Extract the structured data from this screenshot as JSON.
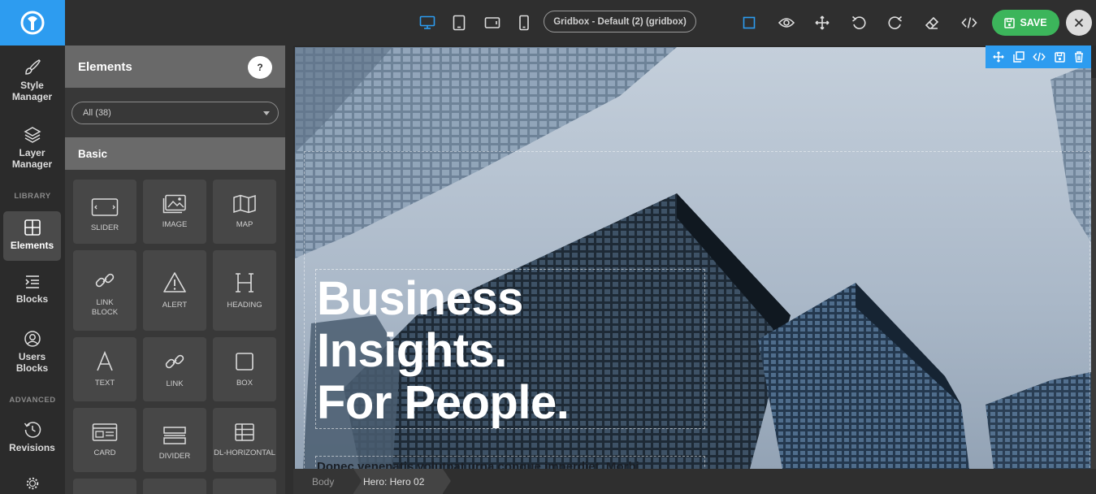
{
  "toolbar": {
    "device_icons": [
      "desktop-icon",
      "tablet-icon",
      "tablet-landscape-icon",
      "phone-icon"
    ],
    "preset_label": "Gridbox - Default (2) (gridbox)",
    "tool_icons": [
      "select-square-icon",
      "eye-icon",
      "move-icon",
      "undo-icon",
      "redo-icon",
      "eraser-icon",
      "code-icon"
    ],
    "save_label": "SAVE",
    "accent_color": "#2d9cf0",
    "save_color": "#3cb55b"
  },
  "rail": {
    "items": [
      {
        "label_1": "Style",
        "label_2": "Manager",
        "icon": "brush-icon"
      },
      {
        "label_1": "Layer",
        "label_2": "Manager",
        "icon": "layers-icon"
      },
      {
        "label_1": "Elements",
        "icon": "grid-icon"
      },
      {
        "label_1": "Blocks",
        "icon": "blocks-icon"
      },
      {
        "label_1": "Users",
        "label_2": "Blocks",
        "icon": "user-icon"
      },
      {
        "label_1": "Revisions",
        "icon": "history-icon"
      }
    ],
    "library_label": "LIBRARY",
    "advanced_label": "ADVANCED"
  },
  "panel": {
    "title": "Elements",
    "help_label": "?",
    "filter_value": "All (38)",
    "section_label": "Basic",
    "tiles": [
      {
        "label_1": "SLIDER",
        "icon": "slider-icon"
      },
      {
        "label_1": "IMAGE",
        "icon": "image-icon"
      },
      {
        "label_1": "MAP",
        "icon": "map-icon"
      },
      {
        "label_1": "LINK",
        "label_2": "BLOCK",
        "icon": "link-block-icon"
      },
      {
        "label_1": "ALERT",
        "icon": "alert-icon"
      },
      {
        "label_1": "HEADING",
        "icon": "heading-icon"
      },
      {
        "label_1": "TEXT",
        "icon": "text-icon"
      },
      {
        "label_1": "LINK",
        "icon": "link-icon"
      },
      {
        "label_1": "BOX",
        "icon": "box-icon"
      },
      {
        "label_1": "CARD",
        "icon": "card-icon"
      },
      {
        "label_1": "DIVIDER",
        "icon": "divider-icon"
      },
      {
        "label_1": "DL-HORIZONTAL",
        "icon": "table-icon"
      }
    ]
  },
  "hero": {
    "heading_line_1": "Business",
    "heading_line_2": "Insights.",
    "heading_line_3": "For People.",
    "text": "Donec venenatis volutpat urna congue imperdiet. Morbi"
  },
  "breadcrumb": {
    "item_1": "Body",
    "item_2": "Hero: Hero 02"
  }
}
